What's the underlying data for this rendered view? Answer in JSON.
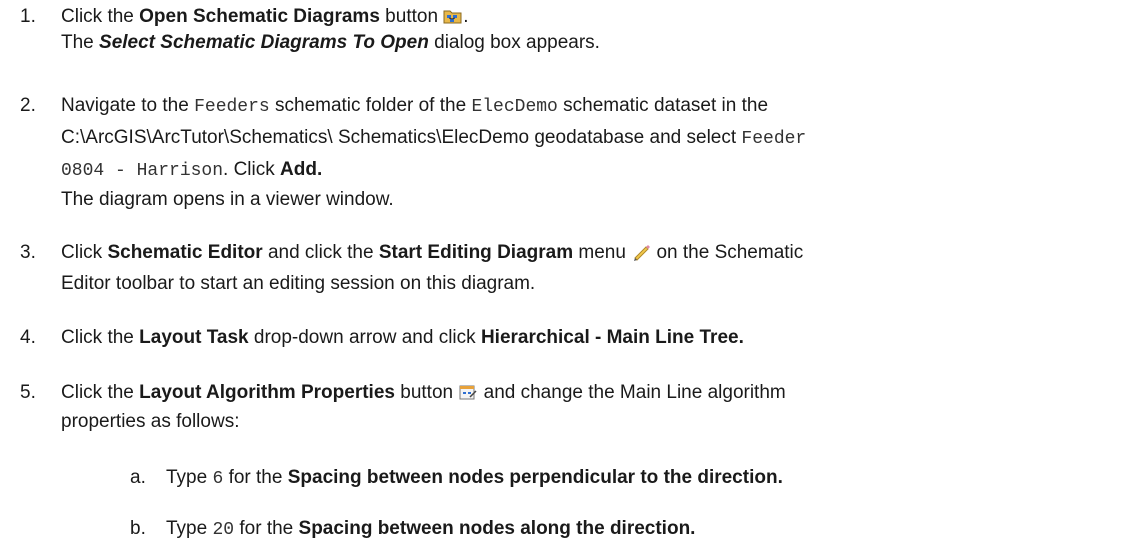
{
  "steps": [
    {
      "num": "1.",
      "l1a": "Click the ",
      "l1b": "Open Schematic Diagrams",
      "l1c": " button ",
      "l1d": ".",
      "icon": "open-schematic-diagrams-icon",
      "l2a": "The ",
      "l2b": "Select Schematic Diagrams To Open",
      "l2c": " dialog box appears."
    },
    {
      "num": "2.",
      "l1a": "Navigate to the ",
      "l1b": "Feeders",
      "l1c": " schematic folder of the ",
      "l1d": "ElecDemo",
      "l1e": " schematic dataset in the",
      "l2a": "C:\\ArcGIS\\ArcTutor\\Schematics\\ Schematics\\ElecDemo geodatabase and select ",
      "l2b": "Feeder",
      "l3a": "0804 - Harrison",
      "l3b": ". Click ",
      "l3c": "Add.",
      "l4": "The diagram opens in a viewer window."
    },
    {
      "num": "3.",
      "l1a": "Click ",
      "l1b": "Schematic Editor",
      "l1c": " and click the ",
      "l1d": "Start Editing Diagram",
      "l1e": " menu ",
      "l1f": " on the Schematic",
      "icon": "start-editing-pencil-icon",
      "l2": "Editor toolbar to start an editing session on this diagram."
    },
    {
      "num": "4.",
      "l1a": "Click the ",
      "l1b": "Layout Task",
      "l1c": " drop-down arrow and click ",
      "l1d": "Hierarchical - Main Line Tree."
    },
    {
      "num": "5.",
      "l1a": "Click the ",
      "l1b": "Layout Algorithm Properties",
      "l1c": " button ",
      "l1d": " and change the Main Line algorithm",
      "icon": "layout-algorithm-properties-icon",
      "l2": "properties as follows:"
    }
  ],
  "substeps": [
    {
      "letter": "a.",
      "a": "Type ",
      "b": "6",
      "c": " for the ",
      "d": "Spacing between nodes perpendicular to the direction."
    },
    {
      "letter": "b.",
      "a": "Type ",
      "b": "20",
      "c": " for the ",
      "d": "Spacing between nodes along the direction."
    }
  ]
}
